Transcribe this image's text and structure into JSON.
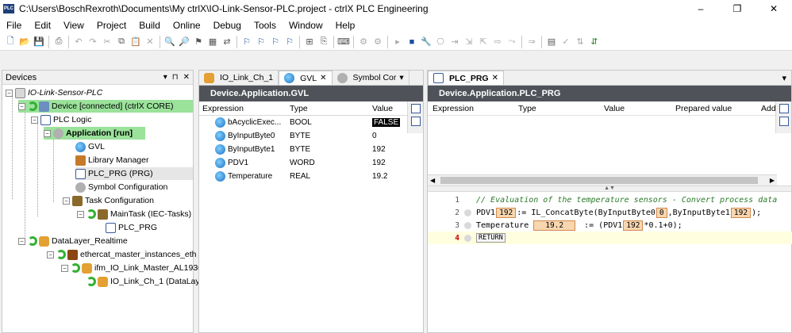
{
  "window": {
    "title": "C:\\Users\\BoschRexroth\\Documents\\My ctrlX\\IO-Link-Sensor-PLC.project - ctrlX PLC Engineering",
    "app_icon_text": "PLC",
    "controls": [
      "–",
      "❐",
      "✕"
    ]
  },
  "menu": [
    "File",
    "Edit",
    "View",
    "Project",
    "Build",
    "Online",
    "Debug",
    "Tools",
    "Window",
    "Help"
  ],
  "devices": {
    "title": "Devices",
    "panel_controls": [
      "▾",
      "⊓",
      "✕"
    ],
    "tree": [
      {
        "label": "IO-Link-Sensor-PLC"
      },
      {
        "label": "Device [connected] (ctrlX CORE)"
      },
      {
        "label": "PLC Logic"
      },
      {
        "label": "Application [run]"
      },
      {
        "label": "GVL"
      },
      {
        "label": "Library Manager"
      },
      {
        "label": "PLC_PRG (PRG)"
      },
      {
        "label": "Symbol Configuration"
      },
      {
        "label": "Task Configuration"
      },
      {
        "label": "MainTask (IEC-Tasks)"
      },
      {
        "label": "PLC_PRG"
      },
      {
        "label": "DataLayer_Realtime"
      },
      {
        "label": "ethercat_master_instances_eth"
      },
      {
        "label": "ifm_IO_Link_Master_AL1930"
      },
      {
        "label": "IO_Link_Ch_1 (DataLay"
      }
    ]
  },
  "gvl_panel": {
    "tabs": [
      {
        "label": "IO_Link_Ch_1"
      },
      {
        "label": "GVL",
        "close": "✕"
      },
      {
        "label": "Symbol Cor",
        "arrow": "▾"
      }
    ],
    "title": "Device.Application.GVL",
    "headers": {
      "expression": "Expression",
      "type": "Type",
      "value": "Value"
    },
    "rows": [
      {
        "expression": "bAcyclicExec...",
        "type": "BOOL",
        "value": "FALSE"
      },
      {
        "expression": "ByInputByte0",
        "type": "BYTE",
        "value": "0"
      },
      {
        "expression": "ByInputByte1",
        "type": "BYTE",
        "value": "192"
      },
      {
        "expression": "PDV1",
        "type": "WORD",
        "value": "192"
      },
      {
        "expression": "Temperature",
        "type": "REAL",
        "value": "19.2"
      }
    ]
  },
  "prg_panel": {
    "tab": {
      "label": "PLC_PRG",
      "close": "✕",
      "arrow": "▾"
    },
    "title": "Device.Application.PLC_PRG",
    "headers": {
      "expression": "Expression",
      "type": "Type",
      "value": "Value",
      "prepared": "Prepared value",
      "address": "Add"
    },
    "code": {
      "line_numbers": [
        "1",
        "2",
        "3",
        "4"
      ],
      "line1_comment": "// Evaluation of the temperature sensors - Convert process data",
      "line2": {
        "var": "PDV1",
        "box1": "192",
        "assign": ":= IL_ConcatByte(ByInputByte0",
        "box2": "0",
        "mid": ",ByInputByte1",
        "box3": "192",
        "end": ");"
      },
      "line3": {
        "var": "Temperature",
        "box1": "19.2",
        "assign": ":= (PDV1",
        "box2": "192",
        "end": "*0.1+0);"
      },
      "line4": "RETURN"
    }
  }
}
